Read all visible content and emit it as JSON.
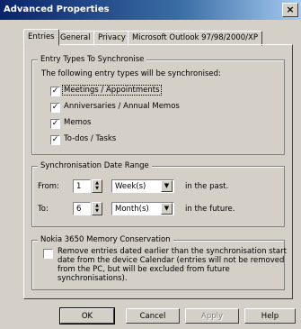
{
  "window": {
    "title": "Advanced Properties",
    "close": "×"
  },
  "tabs": [
    "Entries",
    "General",
    "Privacy",
    "Microsoft Outlook 97/98/2000/XP"
  ],
  "entry_types": {
    "legend": "Entry Types To Synchronise",
    "description": "The following entry types will be synchronised:",
    "items": [
      {
        "label": "Meetings / Appointments",
        "checked": true
      },
      {
        "label": "Anniversaries / Annual Memos",
        "checked": true
      },
      {
        "label": "Memos",
        "checked": true
      },
      {
        "label": "To-dos / Tasks",
        "checked": true
      }
    ]
  },
  "date_range": {
    "legend": "Synchronisation Date Range",
    "from": {
      "label": "From:",
      "value": "1",
      "unit": "Week(s)",
      "suffix": "in the past."
    },
    "to": {
      "label": "To:",
      "value": "6",
      "unit": "Month(s)",
      "suffix": "in the future."
    }
  },
  "memory": {
    "legend": "Nokia 3650 Memory Conservation",
    "lines": [
      "Remove entries dated earlier than the synchronisation start",
      "date from the device Calendar (entries will not be removed",
      "from the PC, but will be excluded from future",
      "synchronisations)."
    ],
    "checked": false
  },
  "buttons": {
    "ok": "OK",
    "cancel": "Cancel",
    "apply": "Apply",
    "help": "Help"
  },
  "icons": {
    "check": "✓",
    "spin_up": "▲",
    "spin_down": "▼",
    "dropdown": "▼"
  }
}
